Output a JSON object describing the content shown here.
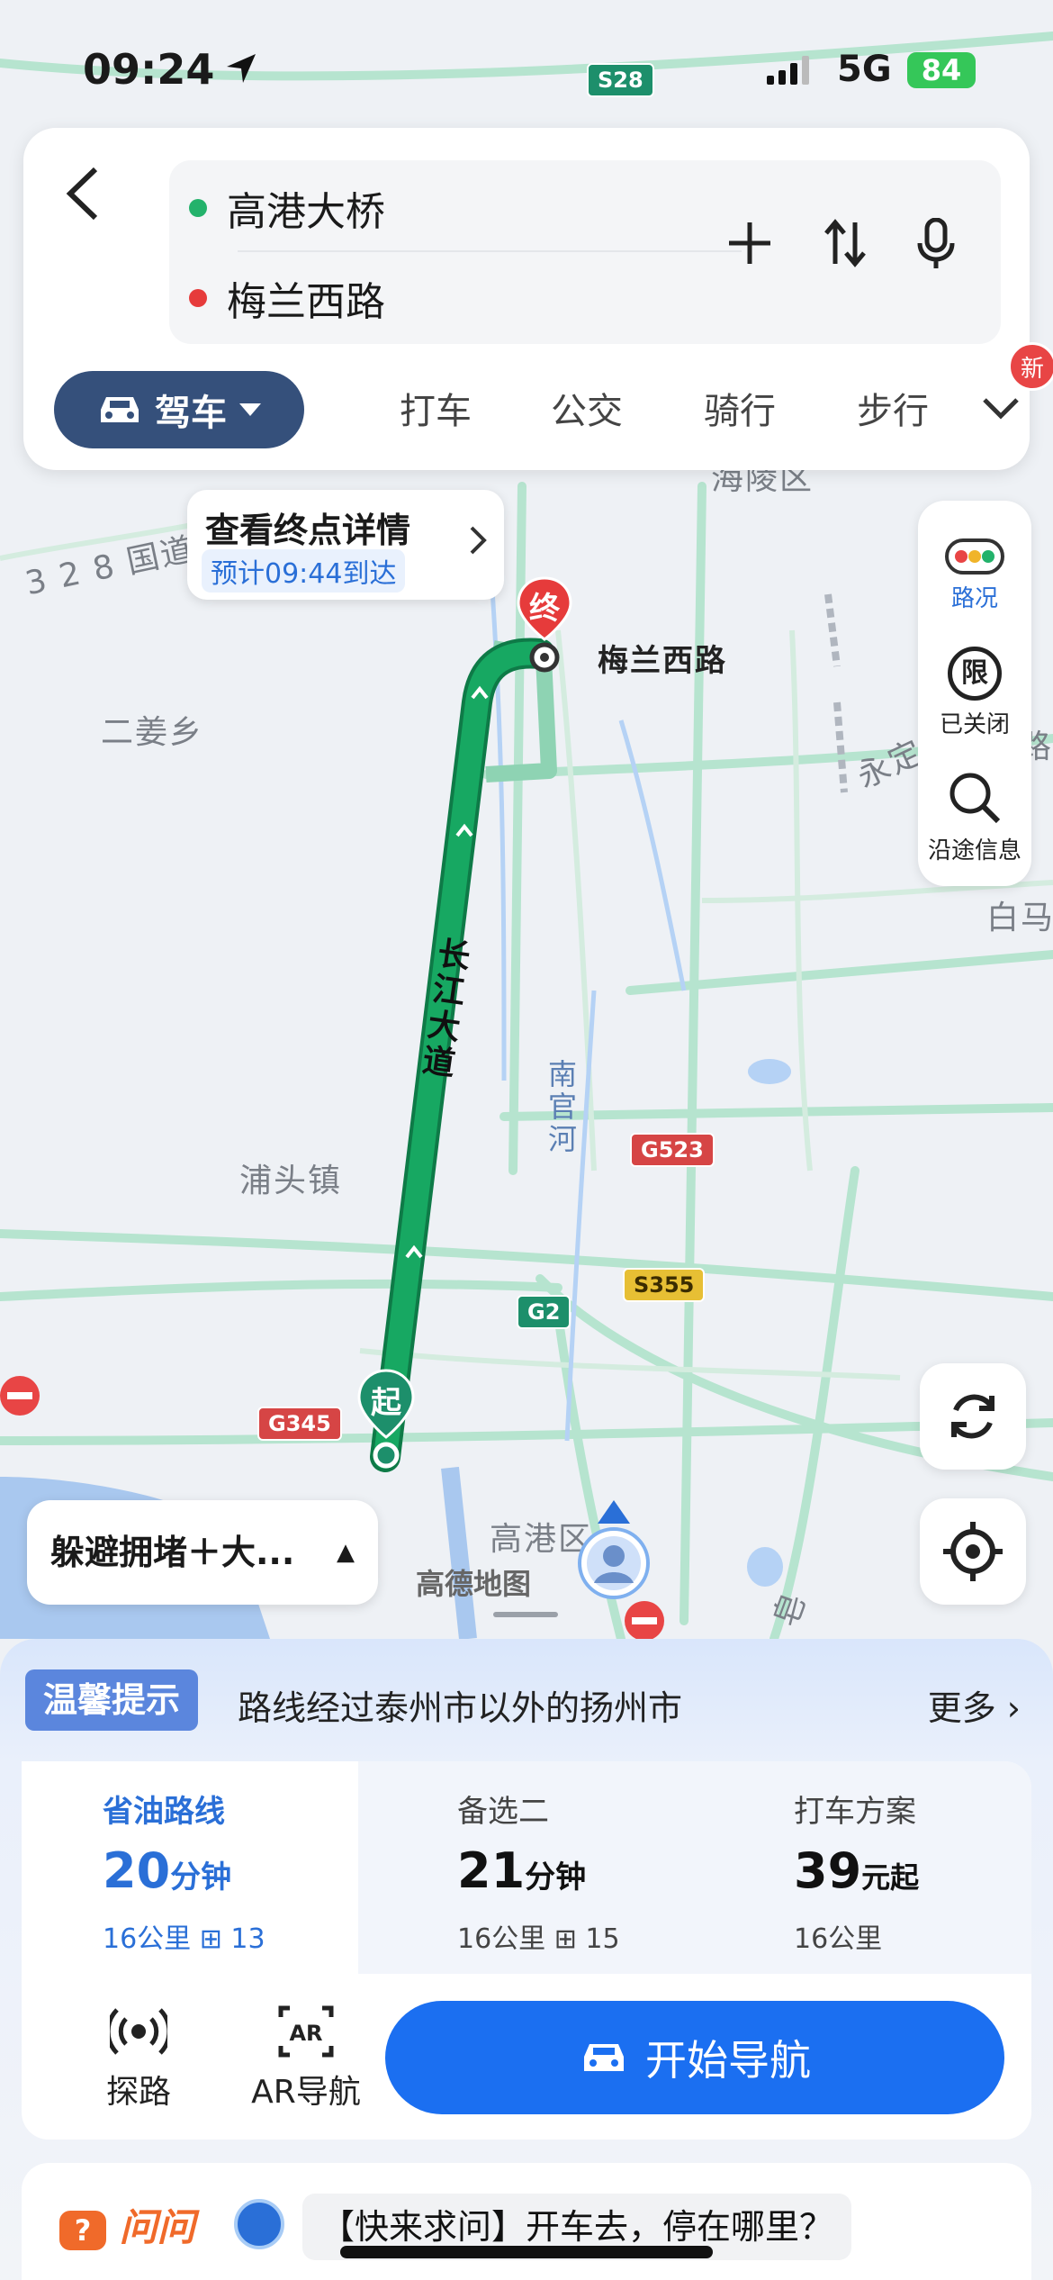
{
  "status_bar": {
    "time": "09:24",
    "network": "5G",
    "battery": "84"
  },
  "route": {
    "origin": "高港大桥",
    "destination": "梅兰西路",
    "origin_color": "#23b26b",
    "destination_color": "#e63b3b"
  },
  "modes": {
    "active": "驾车",
    "items": [
      "打车",
      "公交",
      "骑行",
      "步行"
    ],
    "new_badge": "新"
  },
  "dest_callout": {
    "title": "查看终点详情",
    "eta": "预计09:44到达"
  },
  "map": {
    "route_color": "#17a862",
    "end_marker": "终",
    "start_marker": "起",
    "end_name": "梅兰西路",
    "road_name": "长江大道",
    "river_name": "南官河",
    "labels": {
      "national_road": "3 2 8 国道",
      "town_erjiang": "二姜乡",
      "town_putou": "浦头镇",
      "district_hailing": "海陵区",
      "district_gaogang": "高港区",
      "yongding": "永定",
      "baima": "白马",
      "road_lu": "路",
      "zao": "皂"
    },
    "badges": {
      "s28": "S28",
      "g523": "G523",
      "s355": "S355",
      "g2": "G2",
      "g345": "G345"
    },
    "watermark": "高德地图"
  },
  "tools": {
    "traffic": "路况",
    "restriction": "已关闭",
    "restriction_icon": "限",
    "along_route": "沿途信息"
  },
  "avoid": {
    "label": "躲避拥堵＋大..."
  },
  "tip": {
    "tag": "温馨提示",
    "message": "路线经过泰州市以外的扬州市",
    "more": "更多"
  },
  "plans": [
    {
      "name": "省油路线",
      "time": "20",
      "unit": "分钟",
      "distance": "16公里",
      "lights": "13"
    },
    {
      "name": "备选二",
      "time": "21",
      "unit": "分钟",
      "distance": "16公里",
      "lights": "15"
    },
    {
      "name": "打车方案",
      "time": "39",
      "unit": "元起",
      "distance": "16公里",
      "lights": ""
    }
  ],
  "actions": {
    "explore": "探路",
    "ar": "AR导航",
    "start": "开始导航"
  },
  "ask": {
    "brand": "问问",
    "question": "【快来求问】开车去，停在哪里？"
  }
}
